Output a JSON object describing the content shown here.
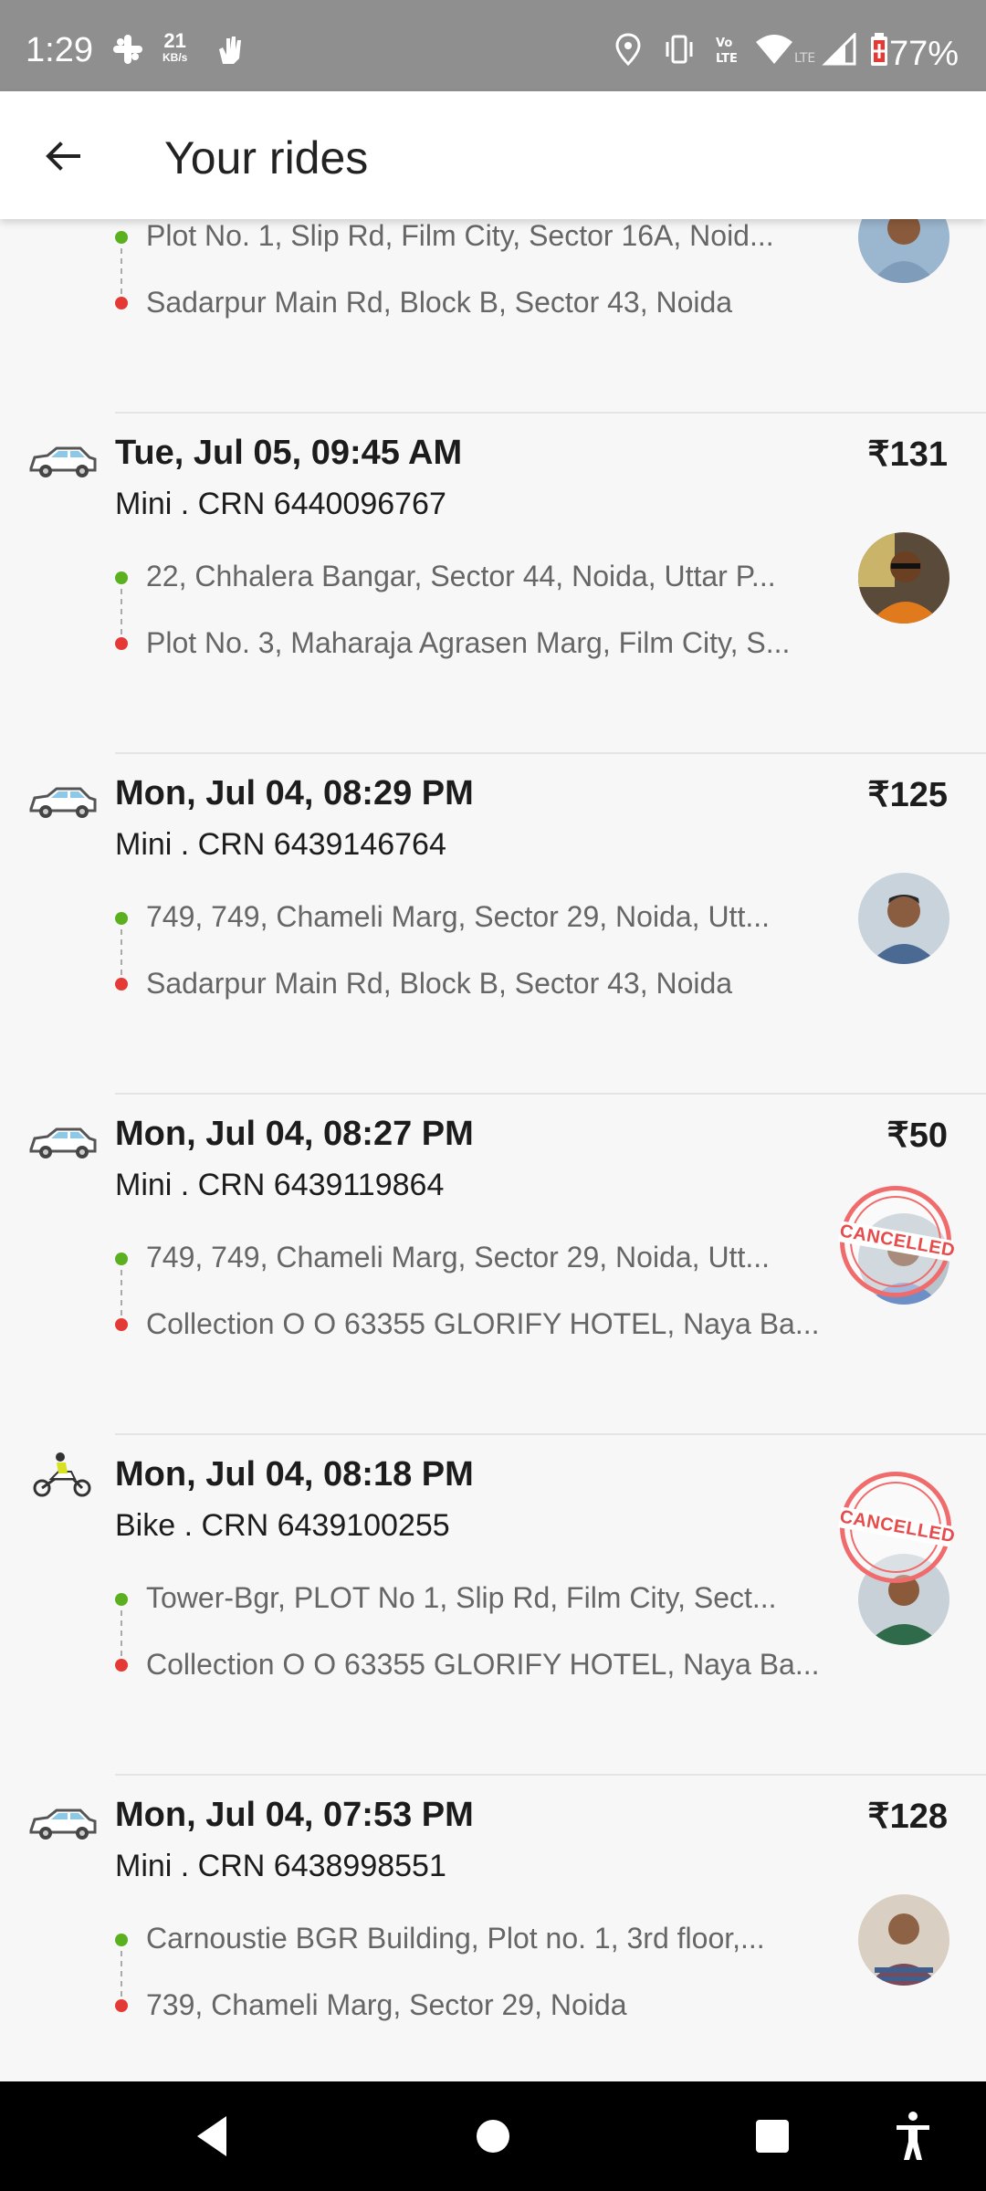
{
  "status_bar": {
    "time": "1:29",
    "net_speed_value": "21",
    "net_speed_unit": "KB/s",
    "battery": "77%",
    "icons": [
      "slack-icon",
      "hand-icon",
      "location-icon",
      "vibrate-icon",
      "volte-icon",
      "wifi-icon",
      "signal-icon",
      "battery-icon"
    ]
  },
  "header": {
    "title": "Your rides"
  },
  "partial_ride": {
    "pickup": "Plot No. 1, Slip Rd, Film City, Sector 16A, Noid...",
    "drop": "Sadarpur Main Rd, Block B, Sector 43, Noida"
  },
  "rides": [
    {
      "vehicle": "car-icon",
      "date": "Tue, Jul 05, 09:45 AM",
      "fare": "₹131",
      "meta": "Mini . CRN 6440096767",
      "pickup": "22, Chhalera Bangar, Sector 44, Noida, Uttar P...",
      "drop": "Plot No. 3, Maharaja Agrasen Marg, Film City, S..."
    },
    {
      "vehicle": "car-icon",
      "date": "Mon, Jul 04, 08:29 PM",
      "fare": "₹125",
      "meta": "Mini . CRN 6439146764",
      "pickup": "749, 749, Chameli Marg, Sector 29, Noida, Utt...",
      "drop": "Sadarpur Main Rd, Block B, Sector 43, Noida"
    },
    {
      "vehicle": "car-icon",
      "date": "Mon, Jul 04, 08:27 PM",
      "fare": "₹50",
      "meta": "Mini . CRN 6439119864",
      "pickup": "749, 749, Chameli Marg, Sector 29, Noida, Utt...",
      "drop": "Collection O O 63355 GLORIFY HOTEL, Naya Ba...",
      "stamp": "CANCELLED"
    },
    {
      "vehicle": "bike-icon",
      "date": "Mon, Jul 04, 08:18 PM",
      "fare": "",
      "meta": "Bike . CRN 6439100255",
      "pickup": "Tower-Bgr, PLOT No 1, Slip Rd, Film City, Sect...",
      "drop": "Collection O O 63355 GLORIFY HOTEL, Naya Ba...",
      "stamp": "CANCELLED"
    },
    {
      "vehicle": "car-icon",
      "date": "Mon, Jul 04, 07:53 PM",
      "fare": "₹128",
      "meta": "Mini . CRN 6438998551",
      "pickup": "Carnoustie BGR Building, Plot no. 1, 3rd floor,...",
      "drop": "739, Chameli Marg, Sector 29, Noida"
    }
  ],
  "colors": {
    "pickup_dot": "#5ab01e",
    "drop_dot": "#e53935",
    "stamp": "#f06b6b"
  }
}
